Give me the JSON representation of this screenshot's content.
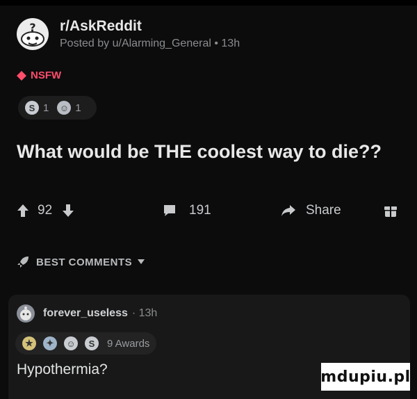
{
  "post": {
    "subreddit": "r/AskReddit",
    "posted_by": "Posted by u/Alarming_General • 13h",
    "nsfw_label": "NSFW",
    "awards": [
      {
        "icon": "silver-award-icon",
        "count": "1"
      },
      {
        "icon": "wholesome-award-icon",
        "count": "1"
      }
    ],
    "title": "What would be THE coolest way to die??",
    "upvotes": "92",
    "comment_count": "191",
    "share_label": "Share"
  },
  "sort": {
    "label": "BEST COMMENTS"
  },
  "comment": {
    "author": "forever_useless",
    "time": "· 13h",
    "awards_label": "9 Awards",
    "body": "Hypothermia?"
  },
  "watermark": "mdupiu.pl",
  "colors": {
    "background": "#0c0c0d",
    "nsfw": "#ff4d6a",
    "text": "#d7dadc"
  }
}
